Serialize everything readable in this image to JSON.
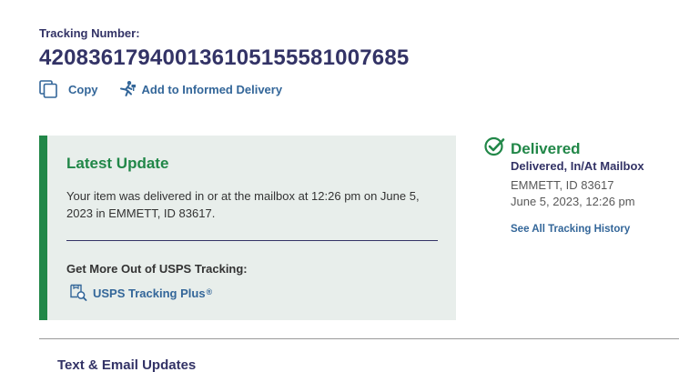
{
  "tracking": {
    "label": "Tracking Number:",
    "number": "420836179400136105155581007685"
  },
  "actions": {
    "copy_label": "Copy",
    "informed_delivery_label": "Add to Informed Delivery"
  },
  "latest_update": {
    "title": "Latest Update",
    "text": "Your item was delivered in or at the mailbox at 12:26 pm on June 5, 2023 in EMMETT, ID 83617.",
    "promo_heading": "Get More Out of USPS Tracking:",
    "promo_link_label": "USPS Tracking Plus",
    "promo_link_mark": "®"
  },
  "status": {
    "title": "Delivered",
    "detail": "Delivered, In/At Mailbox",
    "location": "EMMETT, ID 83617",
    "time": "June 5, 2023, 12:26 pm",
    "history_link": "See All Tracking History"
  },
  "sections": {
    "text_email_heading": "Text & Email Updates"
  },
  "colors": {
    "navy": "#333366",
    "green": "#218748",
    "link_blue": "#336699",
    "panel_bg": "#e8eeeb"
  },
  "icons": {
    "copy": "copy-icon",
    "informed_delivery": "informed-delivery-icon",
    "tracking_plus": "tracking-plus-icon",
    "delivered": "check-circle-icon"
  }
}
